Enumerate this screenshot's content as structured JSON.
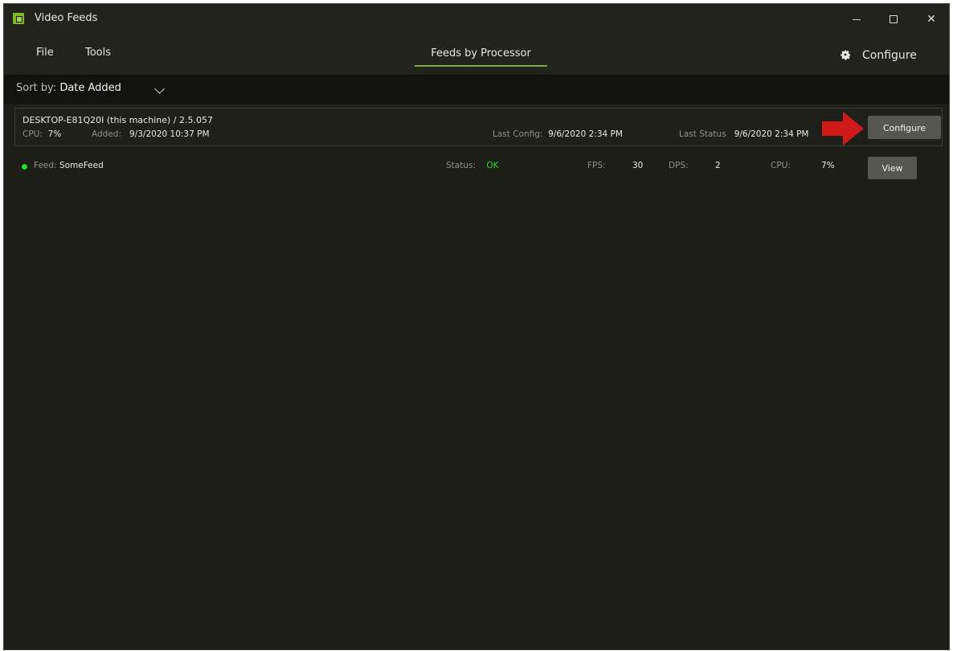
{
  "window": {
    "title": "Video Feeds"
  },
  "menu": {
    "file": "File",
    "tools": "Tools",
    "active_tab": "Feeds by Processor",
    "configure": "Configure"
  },
  "sort": {
    "label": "Sort by:",
    "value": "Date Added"
  },
  "processor": {
    "name": "DESKTOP-E81Q20I (this machine) / 2.5.057",
    "cpu_label": "CPU:",
    "cpu_value": "7%",
    "added_label": "Added:",
    "added_value": "9/3/2020 10:37 PM",
    "last_config_label": "Last Config:",
    "last_config_value": "9/6/2020 2:34 PM",
    "last_status_label": "Last Status",
    "last_status_value": "9/6/2020 2:34 PM",
    "configure_button": "Configure"
  },
  "feed": {
    "feed_label": "Feed:",
    "feed_name": "SomeFeed",
    "status_label": "Status:",
    "status_value": "OK",
    "fps_label": "FPS:",
    "fps_value": "30",
    "dps_label": "DPS:",
    "dps_value": "2",
    "cpu_label": "CPU:",
    "cpu_value": "7%",
    "view_button": "View"
  },
  "colors": {
    "accent": "#7fa83a",
    "status_ok": "#2ad62a",
    "annotation_arrow": "#d01a1a"
  }
}
